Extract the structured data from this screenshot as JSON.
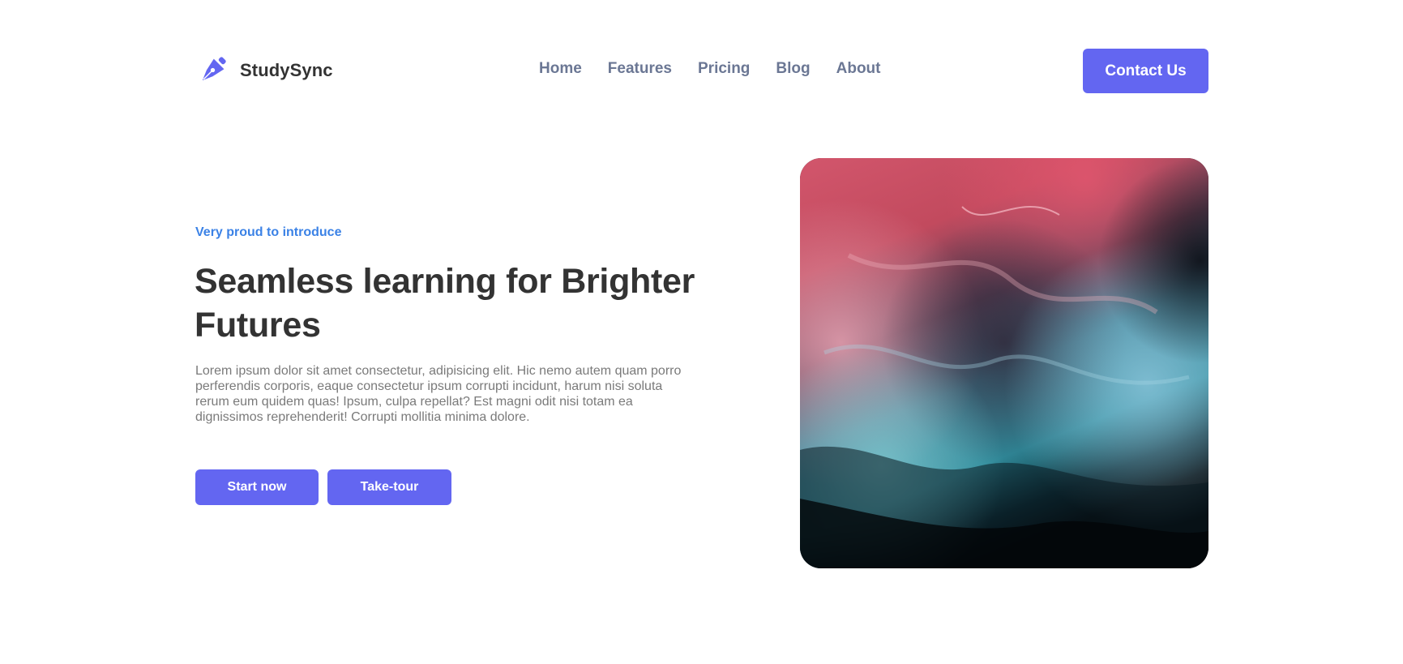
{
  "brand": {
    "name": "StudySync",
    "logo_icon": "pen-nib-icon",
    "accent_color": "#6366f1"
  },
  "nav": {
    "items": [
      {
        "label": "Home"
      },
      {
        "label": "Features"
      },
      {
        "label": "Pricing"
      },
      {
        "label": "Blog"
      },
      {
        "label": "About"
      }
    ],
    "contact_label": "Contact Us"
  },
  "hero": {
    "eyebrow": "Very proud to introduce",
    "title": "Seamless learning for Brighter Futures",
    "description": "Lorem ipsum dolor sit amet consectetur, adipisicing elit. Hic nemo autem quam porro perferendis corporis, eaque consectetur ipsum corrupti incidunt, harum nisi soluta rerum eum quidem quas! Ipsum, culpa repellat? Est magni odit nisi totam ea dignissimos reprehenderit! Corrupti mollitia minima dolore.",
    "start_label": "Start now",
    "tour_label": "Take-tour",
    "eyebrow_color": "#3b82e6"
  }
}
